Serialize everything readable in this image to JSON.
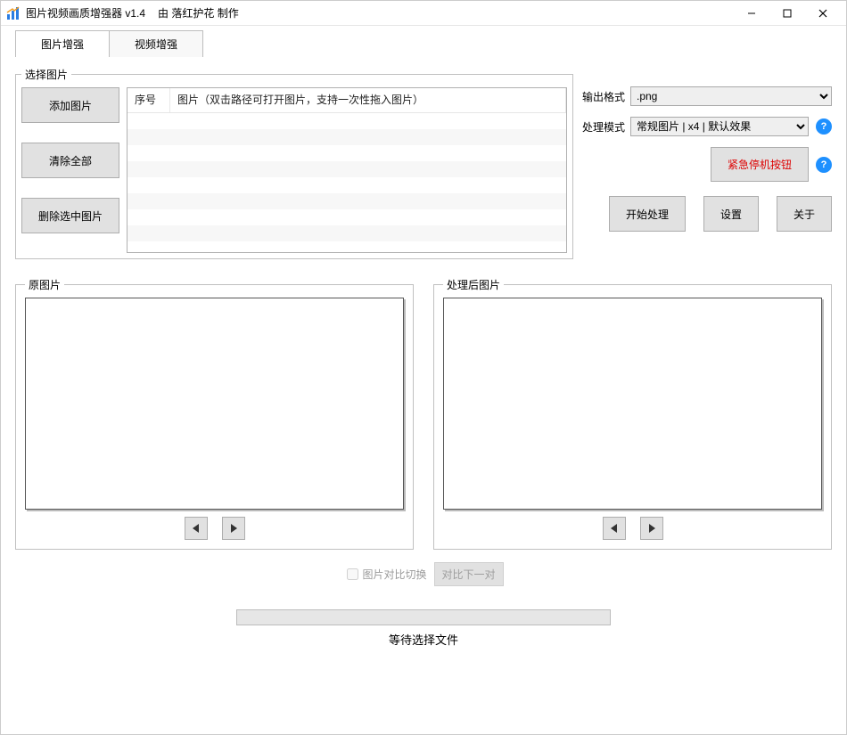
{
  "window": {
    "title": "图片视频画质增强器 v1.4",
    "author": "由 落红护花 制作"
  },
  "tabs": [
    {
      "label": "图片增强",
      "active": true
    },
    {
      "label": "视频增强",
      "active": false
    }
  ],
  "select_group": {
    "legend": "选择图片",
    "buttons": {
      "add": "添加图片",
      "clear": "清除全部",
      "delete": "删除选中图片"
    },
    "list": {
      "col1": "序号",
      "col2": "图片（双击路径可打开图片，支持一次性拖入图片）"
    }
  },
  "right": {
    "output_format_label": "输出格式",
    "output_format_value": ".png",
    "mode_label": "处理模式",
    "mode_value": "常规图片 | x4 | 默认效果",
    "emergency": "紧急停机按钮",
    "start": "开始处理",
    "settings": "设置",
    "about": "关于"
  },
  "preview": {
    "original_legend": "原图片",
    "processed_legend": "处理后图片"
  },
  "compare": {
    "checkbox_label": "图片对比切换",
    "next_button": "对比下一对"
  },
  "status": "等待选择文件"
}
